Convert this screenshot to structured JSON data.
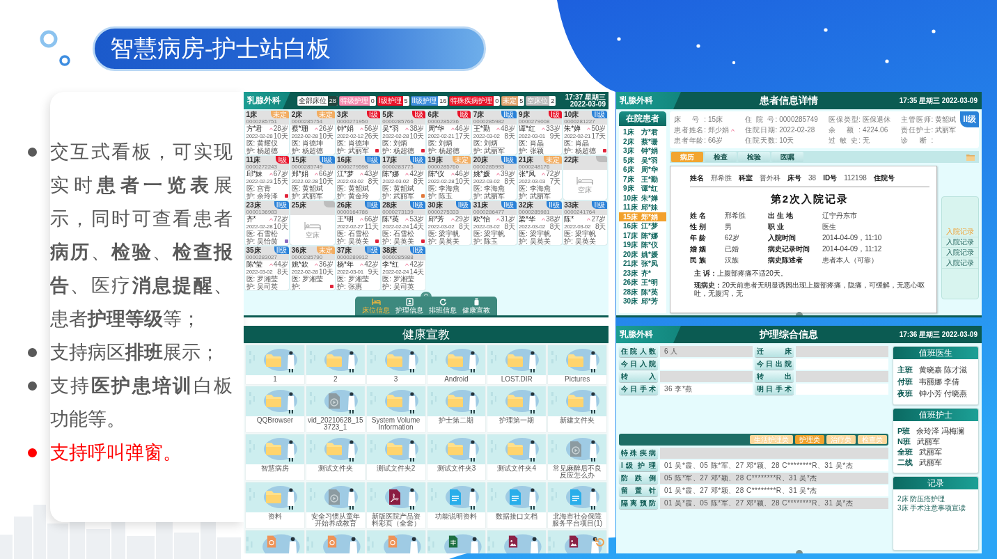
{
  "title": "智慧病房-护士站白板",
  "bullets": [
    {
      "text": "交互式看板，可实现实时**患者一览表**展示，同时可查看患者**病历**、**检验**、**检查报告**、医疗**消息提醒**、患者**护理等级**等；",
      "color": "#595959"
    },
    {
      "text": "支持病区**排班**展示；",
      "color": "#595959"
    },
    {
      "text": "支持**医护患培训**白板功能等。",
      "color": "#595959"
    },
    {
      "text": "支持呼叫弹窗。",
      "color": "#ff0000"
    }
  ],
  "bed_board": {
    "department": "乳腺外科",
    "clock": "17:37 星期三 2022-03-09",
    "summary": [
      {
        "kind": "total",
        "label": "全部床位",
        "count": "28",
        "color": "#ffffff"
      },
      {
        "kind": "category",
        "label": "特级护理",
        "count": "0",
        "color": "#f48cb0"
      },
      {
        "kind": "category",
        "label": "I级护理",
        "count": "5",
        "color": "#e8152b"
      },
      {
        "kind": "category",
        "label": "II级护理",
        "count": "16",
        "color": "#3d8fdd"
      },
      {
        "kind": "category",
        "label": "特殊疾病护理",
        "count": "0",
        "color": "#e8152b"
      },
      {
        "kind": "category",
        "label": "未定",
        "count": "5",
        "color": "#e3a874"
      },
      {
        "kind": "category",
        "label": "空床位",
        "count": "2",
        "color": "#bdbdbd"
      }
    ],
    "beds": [
      {
        "kind": "occupied",
        "bed": "1床",
        "id": "0000285751",
        "badge": {
          "text": "未定",
          "color": "#f2ad62"
        },
        "name": "方*君",
        "age": "28岁",
        "date": "2022-02-28",
        "days": "10天",
        "doctor": "医: 黄耀仪",
        "nurse": "护: 杨超德"
      },
      {
        "kind": "occupied",
        "bed": "2床",
        "id": "0000285754",
        "badge": {
          "text": "未定",
          "color": "#f2ad62"
        },
        "name": "蔡*珊",
        "age": "26岁",
        "date": "2022-02-28",
        "days": "10天",
        "doctor": "医: 肖德坤",
        "nurse": "护: 杨超德"
      },
      {
        "kind": "occupied",
        "bed": "3床",
        "id": "0000271950",
        "badge": {
          "text": "I级",
          "color": "#e8152b"
        },
        "name": "钟*娟",
        "age": "56岁",
        "date": "2022-02-12",
        "days": "26天",
        "doctor": "医: 肖德坤",
        "nurse": "护: 武丽军",
        "tag": {
          "color": "#e0243a"
        }
      },
      {
        "kind": "occupied",
        "bed": "5床",
        "id": "0000285766",
        "badge": {
          "text": "I级",
          "color": "#e8152b"
        },
        "name": "吴*羽",
        "age": "38岁",
        "date": "2022-02-28",
        "days": "10天",
        "doctor": "医: 刘炳",
        "nurse": "护: 杨超德",
        "tag": {
          "color": "#e0243a"
        }
      },
      {
        "kind": "occupied",
        "bed": "6床",
        "id": "0000285236",
        "badge": {
          "text": "I级",
          "color": "#e8152b"
        },
        "name": "周*华",
        "age": "46岁",
        "date": "2022-02-21",
        "days": "17天",
        "doctor": "医: 刘炳",
        "nurse": "护: 杨超德"
      },
      {
        "kind": "occupied",
        "bed": "7床",
        "id": "0000285982",
        "badge": {
          "text": "II级",
          "color": "#2a82d8"
        },
        "name": "王*勤",
        "age": "48岁",
        "date": "2022-03-02",
        "days": "8天",
        "doctor": "医: 刘炳",
        "nurse": "护: 武丽军"
      },
      {
        "kind": "occupied",
        "bed": "9床",
        "id": "0000279008",
        "badge": {
          "text": "I级",
          "color": "#e8152b"
        },
        "name": "谭*红",
        "age": "33岁",
        "date": "2022-03-01",
        "days": "9天",
        "doctor": "医: 肖晶",
        "nurse": "护: 张颖"
      },
      {
        "kind": "occupied",
        "bed": "10床",
        "id": "0000281227",
        "badge": {
          "text": "II级",
          "color": "#2a82d8"
        },
        "name": "朱*婵",
        "age": "50岁",
        "date": "2022-02-21",
        "days": "17天",
        "doctor": "医: 肖晶",
        "nurse": "护: 杨超德",
        "tag": {
          "color": "#e0243a"
        }
      },
      {
        "kind": "occupied",
        "bed": "11床",
        "id": "0000272243",
        "badge": {
          "text": "I级",
          "color": "#e8152b"
        },
        "name": "邱*妹",
        "age": "67岁",
        "date": "2022-02-23",
        "days": "15天",
        "doctor": "医: 宫青",
        "nurse": "护: 余玲泽",
        "tag": {
          "color": "#e0243a"
        }
      },
      {
        "kind": "occupied",
        "bed": "15床",
        "id": "0000285749",
        "badge": {
          "text": "II级",
          "color": "#2a82d8"
        },
        "name": "郑*娟",
        "age": "66岁",
        "date": "2022-02-28",
        "days": "10天",
        "doctor": "医: 黄韶斌",
        "nurse": "护: 武丽军"
      },
      {
        "kind": "occupied",
        "bed": "16床",
        "id": "0000279598",
        "badge": {
          "text": "II级",
          "color": "#2a82d8"
        },
        "name": "江*梦",
        "age": "43岁",
        "date": "2022-03-02",
        "days": "8天",
        "doctor": "医: 黄韶斌",
        "nurse": "护: 黄金玲"
      },
      {
        "kind": "occupied",
        "bed": "17床",
        "id": "0000283773",
        "badge": {
          "text": "II级",
          "color": "#2a82d8"
        },
        "name": "陈*娜",
        "age": "42岁",
        "date": "2022-03-02",
        "days": "8天",
        "doctor": "医: 黄韶斌",
        "nurse": "护: 武丽军",
        "tag": {
          "color": "#e0783a"
        }
      },
      {
        "kind": "occupied",
        "bed": "19床",
        "id": "0000285760",
        "badge": {
          "text": "未定",
          "color": "#f2ad62"
        },
        "name": "陈*仪",
        "age": "46岁",
        "date": "2022-02-28",
        "days": "10天",
        "doctor": "医: 李海燕",
        "nurse": "护: 陈玉"
      },
      {
        "kind": "occupied",
        "bed": "20床",
        "id": "0000285993",
        "badge": {
          "text": "II级",
          "color": "#2a82d8"
        },
        "name": "姚*媛",
        "age": "39岁",
        "date": "2022-03-02",
        "days": "8天",
        "doctor": "医: 李海燕",
        "nurse": "护: 武丽军"
      },
      {
        "kind": "occupied",
        "bed": "21床",
        "id": "0000248176",
        "badge": {
          "text": "未定",
          "color": "#f2ad62"
        },
        "name": "张*凤",
        "age": "72岁",
        "date": "2022-03-03",
        "days": "7天",
        "doctor": "医: 李海燕",
        "nurse": "护: 武丽军"
      },
      {
        "kind": "empty",
        "bed": "22床",
        "badge": {
          "color": "#bdbdbd"
        },
        "caption": "空床"
      },
      {
        "kind": "occupied",
        "bed": "23床",
        "id": "0000136983",
        "badge": {
          "text": "II级",
          "color": "#2a82d8"
        },
        "name": "齐*",
        "age": "72岁",
        "date": "2022-02-28",
        "days": "10天",
        "doctor": "医: 石雪松",
        "nurse": "护: 吴怡茵",
        "tag": {
          "color": "#8a6bc0"
        }
      },
      {
        "kind": "empty",
        "bed": "25床",
        "badge": {
          "color": "#bdbdbd"
        },
        "caption": "空床"
      },
      {
        "kind": "occupied",
        "bed": "26床",
        "id": "0000164786",
        "badge": {
          "text": "II级",
          "color": "#2a82d8"
        },
        "name": "王*明",
        "age": "66岁",
        "date": "2022-02-27",
        "days": "11天",
        "doctor": "医: 石雪松",
        "nurse": "护: 吴英美",
        "tag": {
          "color": "#e0243a"
        }
      },
      {
        "kind": "occupied",
        "bed": "28床",
        "id": "0000273139",
        "badge": {
          "text": "II级",
          "color": "#2a82d8"
        },
        "name": "陈*英",
        "age": "53岁",
        "date": "2022-02-24",
        "days": "14天",
        "doctor": "医: 石雪松",
        "nurse": "护: 吴英美",
        "tag": {
          "color": "#e0243a"
        }
      },
      {
        "kind": "occupied",
        "bed": "30床",
        "id": "0000275333",
        "badge": {
          "text": "II级",
          "color": "#2a82d8"
        },
        "name": "邱*芳",
        "age": "29岁",
        "date": "2022-03-02",
        "days": "8天",
        "doctor": "医: 梁宇帆",
        "nurse": "护: 吴英美"
      },
      {
        "kind": "occupied",
        "bed": "31床",
        "id": "0000286477",
        "badge": {
          "text": "II级",
          "color": "#2a82d8"
        },
        "name": "欧*怡",
        "age": "31岁",
        "date": "2022-03-02",
        "days": "8天",
        "doctor": "医: 梁宇帆",
        "nurse": "护: 陈玉"
      },
      {
        "kind": "occupied",
        "bed": "32床",
        "id": "0000285981",
        "badge": {
          "text": "II级",
          "color": "#2a82d8"
        },
        "name": "梁*华",
        "age": "38岁",
        "date": "2022-03-02",
        "days": "8天",
        "doctor": "医: 梁宇帆",
        "nurse": "护: 吴英美"
      },
      {
        "kind": "occupied",
        "bed": "33床",
        "id": "0000241764",
        "badge": {
          "text": "II级",
          "color": "#2a82d8"
        },
        "name": "陈*",
        "age": "27岁",
        "date": "2022-03-02",
        "days": "8天",
        "doctor": "医: 梁宇帆",
        "nurse": "护: 吴英美"
      },
      {
        "kind": "occupied",
        "bed": "35床",
        "id": "0000283027",
        "badge": {
          "text": "II级",
          "color": "#2a82d8"
        },
        "name": "陈*莹",
        "age": "44岁",
        "date": "2022-03-02",
        "days": "8天",
        "doctor": "医: 罗湘莹",
        "nurse": "护: 吴司英"
      },
      {
        "kind": "occupied",
        "bed": "36床",
        "id": "0000285790",
        "badge": {
          "text": "未定",
          "color": "#f2ad62"
        },
        "name": "姚*欽",
        "age": "36岁",
        "date": "2022-02-28",
        "days": "10天",
        "doctor": "医: 罗湘莹",
        "nurse": "护:",
        "tag": {
          "color": "#e0243a"
        }
      },
      {
        "kind": "occupied",
        "bed": "37床",
        "id": "0000289912",
        "badge": {
          "text": "II级",
          "color": "#2a82d8"
        },
        "name": "杨*年",
        "age": "42岁",
        "date": "2022-03-01",
        "days": "9天",
        "doctor": "医: 罗湘莹",
        "nurse": "护: 张惠"
      },
      {
        "kind": "occupied",
        "bed": "38床",
        "id": "0000285988",
        "badge": {
          "text": "II级",
          "color": "#2a82d8"
        },
        "name": "李*红",
        "age": "42岁",
        "date": "2022-02-24",
        "days": "14天",
        "doctor": "医: 罗湘莹",
        "nurse": "护: 吴司英"
      }
    ],
    "nav": [
      {
        "kind": "bed",
        "label": "床位信息",
        "selected": true
      },
      {
        "kind": "nursing",
        "label": "护理信息",
        "selected": false
      },
      {
        "kind": "schedule",
        "label": "排班信息",
        "selected": false
      },
      {
        "kind": "education",
        "label": "健康宣教",
        "selected": false
      }
    ]
  },
  "patient_detail": {
    "department": "乳腺外科",
    "heading": "患者信息详情",
    "clock": "17:35 星期三 2022-03-09",
    "sidebar": {
      "title": "在院患者",
      "patients": [
        {
          "bed": "1床",
          "name": "方*君",
          "selected": false
        },
        {
          "bed": "2床",
          "name": "蔡*珊",
          "selected": false
        },
        {
          "bed": "3床",
          "name": "钟*娟",
          "selected": false
        },
        {
          "bed": "5床",
          "name": "吴*羽",
          "selected": false
        },
        {
          "bed": "6床",
          "name": "周*华",
          "selected": false
        },
        {
          "bed": "7床",
          "name": "王*勤",
          "selected": false
        },
        {
          "bed": "9床",
          "name": "谭*红",
          "selected": false
        },
        {
          "bed": "10床",
          "name": "朱*婵",
          "selected": false
        },
        {
          "bed": "11床",
          "name": "邱*妹",
          "selected": false
        },
        {
          "bed": "15床",
          "name": "郑*娟",
          "selected": true
        },
        {
          "bed": "16床",
          "name": "江*梦",
          "selected": false
        },
        {
          "bed": "17床",
          "name": "陈*娜",
          "selected": false
        },
        {
          "bed": "19床",
          "name": "陈*仪",
          "selected": false
        },
        {
          "bed": "20床",
          "name": "姚*媛",
          "selected": false
        },
        {
          "bed": "21床",
          "name": "张*凤",
          "selected": false
        },
        {
          "bed": "23床",
          "name": "齐*",
          "selected": false
        },
        {
          "bed": "26床",
          "name": "王*明",
          "selected": false
        },
        {
          "bed": "28床",
          "name": "陈*英",
          "selected": false
        },
        {
          "bed": "30床",
          "name": "邱*芳",
          "selected": false
        }
      ]
    },
    "info": [
      {
        "kind": "text",
        "label": "床 号:",
        "value": "15床"
      },
      {
        "kind": "text",
        "label": "住 院 号:",
        "value": "0000285749"
      },
      {
        "kind": "text",
        "label": "医保类型:",
        "value": "医保退休"
      },
      {
        "kind": "text",
        "label": "主管医师:",
        "value": "黄韶斌"
      },
      {
        "kind": "patient",
        "label": "患者姓名:",
        "value": "郑少娟"
      },
      {
        "kind": "text",
        "label": "住院日期:",
        "value": "2022-02-28"
      },
      {
        "kind": "text",
        "label": "余 额:",
        "value": "4224.06"
      },
      {
        "kind": "text",
        "label": "责任护士:",
        "value": "武丽军"
      },
      {
        "kind": "text",
        "label": "患者年龄:",
        "value": "66岁"
      },
      {
        "kind": "text",
        "label": "住院天数:",
        "value": "10天"
      },
      {
        "kind": "text",
        "label": "过 敏 史:",
        "value": "无"
      },
      {
        "kind": "text",
        "label": "诊 断:"
      }
    ],
    "grade": {
      "text": "II级",
      "color": "#2a82d8"
    },
    "tabs": [
      {
        "label": "病历",
        "selected": true
      },
      {
        "label": "检查",
        "selected": false
      },
      {
        "label": "检验",
        "selected": false
      },
      {
        "label": "医嘱",
        "selected": false
      }
    ],
    "document": {
      "header": [
        {
          "label": "姓名",
          "value": "邢希胜"
        },
        {
          "label": "科室",
          "value": "普外科"
        },
        {
          "label": "床号",
          "value": "38"
        },
        {
          "label": "ID号",
          "value": "112198"
        },
        {
          "label": "住院号"
        }
      ],
      "title": "第2次入院记录",
      "fields": [
        {
          "label": "姓 名",
          "value": "邢希胜"
        },
        {
          "label": "出 生 地",
          "value": "辽宁丹东市"
        },
        {
          "label": "性 别",
          "value": "男"
        },
        {
          "label": "职 业",
          "value": "医生"
        },
        {
          "label": "年 龄",
          "value": "62岁"
        },
        {
          "label": "入院时间",
          "value": "2014-04-09，11:10"
        },
        {
          "label": "婚 姻",
          "value": "已婚"
        },
        {
          "label": "病史记录时间",
          "value": "2014-04-09，11:12"
        },
        {
          "label": "民 族",
          "value": "汉族"
        },
        {
          "label": "病史陈述者",
          "value": "患者本人（可靠）"
        }
      ],
      "paragraphs": [
        "**主 诉：**上腹部疼痛不适20天。",
        "**现病史：**20天前患者无明显诱因出现上腹部疼痛，隐痛，可缓解，无恶心呕吐，无腹泻，无"
      ]
    },
    "records": [
      {
        "label": "入院记录",
        "selected": true
      },
      {
        "label": "入院记录",
        "selected": false
      },
      {
        "label": "入院记录",
        "selected": false
      },
      {
        "label": "入院记录",
        "selected": false
      }
    ]
  },
  "health_education": {
    "title": "健康宣教",
    "files": [
      {
        "kind": "folder",
        "caption": "1"
      },
      {
        "kind": "folder",
        "caption": "2"
      },
      {
        "kind": "folder",
        "caption": "3"
      },
      {
        "kind": "folder",
        "caption": "Android"
      },
      {
        "kind": "folder",
        "caption": "LOST.DIR"
      },
      {
        "kind": "folder",
        "caption": "Pictures"
      },
      {
        "kind": "folder",
        "caption": "QQBrowser"
      },
      {
        "kind": "video",
        "caption": "vid_20210628_153723_1"
      },
      {
        "kind": "folder",
        "caption": "System Volume Information"
      },
      {
        "kind": "folder",
        "caption": "护士第二期"
      },
      {
        "kind": "folder",
        "caption": "护理第一期"
      },
      {
        "kind": "folder",
        "caption": "新建文件夹"
      },
      {
        "kind": "folder",
        "caption": "智慧病房"
      },
      {
        "kind": "folder",
        "caption": "测试文件夹"
      },
      {
        "kind": "folder",
        "caption": "测试文件夹2"
      },
      {
        "kind": "folder",
        "caption": "测试文件夹3"
      },
      {
        "kind": "folder",
        "caption": "测试文件夹4"
      },
      {
        "kind": "video",
        "caption": "常见麻醉后不良反应怎么办"
      },
      {
        "kind": "folder",
        "caption": "资料"
      },
      {
        "kind": "video",
        "caption": "安全习惯从童年开始养成教育"
      },
      {
        "kind": "pdf",
        "caption": "新版医院产品资料彩页（全套）"
      },
      {
        "kind": "document",
        "caption": "功能说明资料"
      },
      {
        "kind": "document",
        "caption": "数据接口文档"
      },
      {
        "kind": "document",
        "caption": "北海市社会保障服务平台项目(1)"
      },
      {
        "kind": "slides"
      },
      {
        "kind": "slides"
      },
      {
        "kind": "slides"
      },
      {
        "kind": "spreadsheet"
      },
      {
        "kind": "image"
      },
      {
        "kind": "image"
      }
    ]
  },
  "nursing_info": {
    "department": "乳腺外科",
    "heading": "护理综合信息",
    "clock": "17:36 星期三 2022-03-09",
    "summary": [
      {
        "label": "住 院 人 数",
        "value": "6 人"
      },
      {
        "label": "迁 床"
      },
      {
        "label": "今 日 入 院"
      },
      {
        "label": "今 日 出 院"
      },
      {
        "label": "转 入"
      },
      {
        "label": "转 出"
      },
      {
        "label": "今 日 手 术",
        "value": "36 李*燕"
      },
      {
        "label": "明 日 手 术"
      }
    ],
    "categories": [
      {
        "label": "生活护理类",
        "selected": false
      },
      {
        "label": "护理类",
        "selected": true
      },
      {
        "label": "治疗类",
        "selected": false
      },
      {
        "label": "检查类",
        "selected": false
      }
    ],
    "care_lists": [
      {
        "label": "特 殊 疾 病"
      },
      {
        "label": "I 级 护 理",
        "value": "01 吴*霞、05 陈*军、27 邓*颖、28 C********R、31 吴*杰"
      },
      {
        "label": "防 跌 倒",
        "value": "05 陈*军、27 邓*颖、28 C********R、31 吴*杰"
      },
      {
        "label": "留 置 针",
        "value": "01 吴*霞、27 邓*颖、28 C********R、31 吴*杰"
      },
      {
        "label": "隔 离 预 防",
        "value": "01 吴*霞、05 陈*军、27 邓*颖、28 C********R、31 吴*杰"
      }
    ],
    "doctors": {
      "title": "值班医生",
      "shifts": [
        {
          "shift": "主班",
          "names": "黄晓嘉 陈才滋"
        },
        {
          "shift": "付班",
          "names": "韦丽娜 李倩"
        },
        {
          "shift": "夜班",
          "names": "钟小芳 付晓燕"
        }
      ]
    },
    "nurses": {
      "title": "值班护士",
      "shifts": [
        {
          "shift": "P班",
          "names": "余玲泽 冯梅澜"
        },
        {
          "shift": "N班",
          "names": "武丽军"
        },
        {
          "shift": "全班",
          "names": "武丽军"
        },
        {
          "shift": "二线",
          "names": "武丽军"
        }
      ]
    },
    "log": {
      "title": "记录",
      "entries": [
        "2床 防压疮护理",
        "3床 手术注意事项宣读"
      ]
    }
  }
}
